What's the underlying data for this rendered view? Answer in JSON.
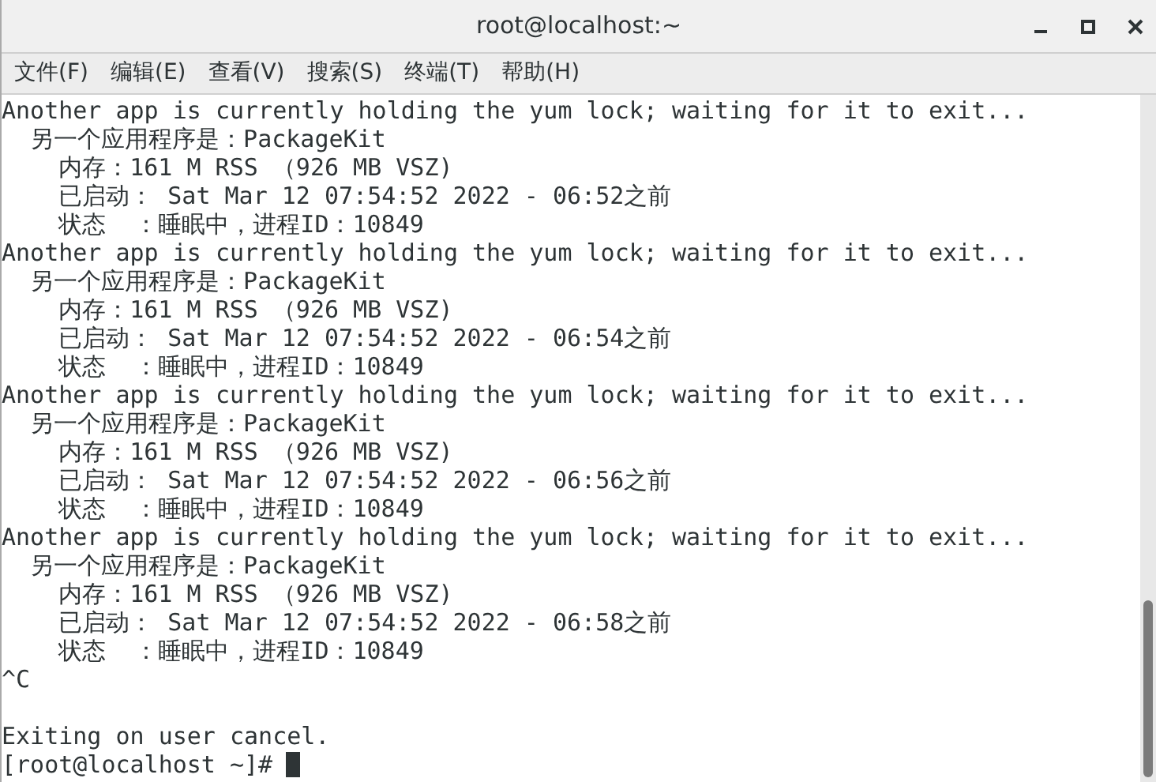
{
  "window": {
    "title": "root@localhost:~"
  },
  "menu": [
    "文件(F)",
    "编辑(E)",
    "查看(V)",
    "搜索(S)",
    "终端(T)",
    "帮助(H)"
  ],
  "terminal": {
    "lines": [
      "Another app is currently holding the yum lock; waiting for it to exit...",
      "  另一个应用程序是：PackageKit",
      "    内存：161 M RSS （926 MB VSZ)",
      "    已启动： Sat Mar 12 07:54:52 2022 - 06:52之前",
      "    状态  ：睡眠中，进程ID：10849",
      "Another app is currently holding the yum lock; waiting for it to exit...",
      "  另一个应用程序是：PackageKit",
      "    内存：161 M RSS （926 MB VSZ)",
      "    已启动： Sat Mar 12 07:54:52 2022 - 06:54之前",
      "    状态  ：睡眠中，进程ID：10849",
      "Another app is currently holding the yum lock; waiting for it to exit...",
      "  另一个应用程序是：PackageKit",
      "    内存：161 M RSS （926 MB VSZ)",
      "    已启动： Sat Mar 12 07:54:52 2022 - 06:56之前",
      "    状态  ：睡眠中，进程ID：10849",
      "Another app is currently holding the yum lock; waiting for it to exit...",
      "  另一个应用程序是：PackageKit",
      "    内存：161 M RSS （926 MB VSZ)",
      "    已启动： Sat Mar 12 07:54:52 2022 - 06:58之前",
      "    状态  ：睡眠中，进程ID：10849",
      "^C"
    ],
    "message": "Exiting on user cancel.",
    "prompt": "[root@localhost ~]#"
  }
}
